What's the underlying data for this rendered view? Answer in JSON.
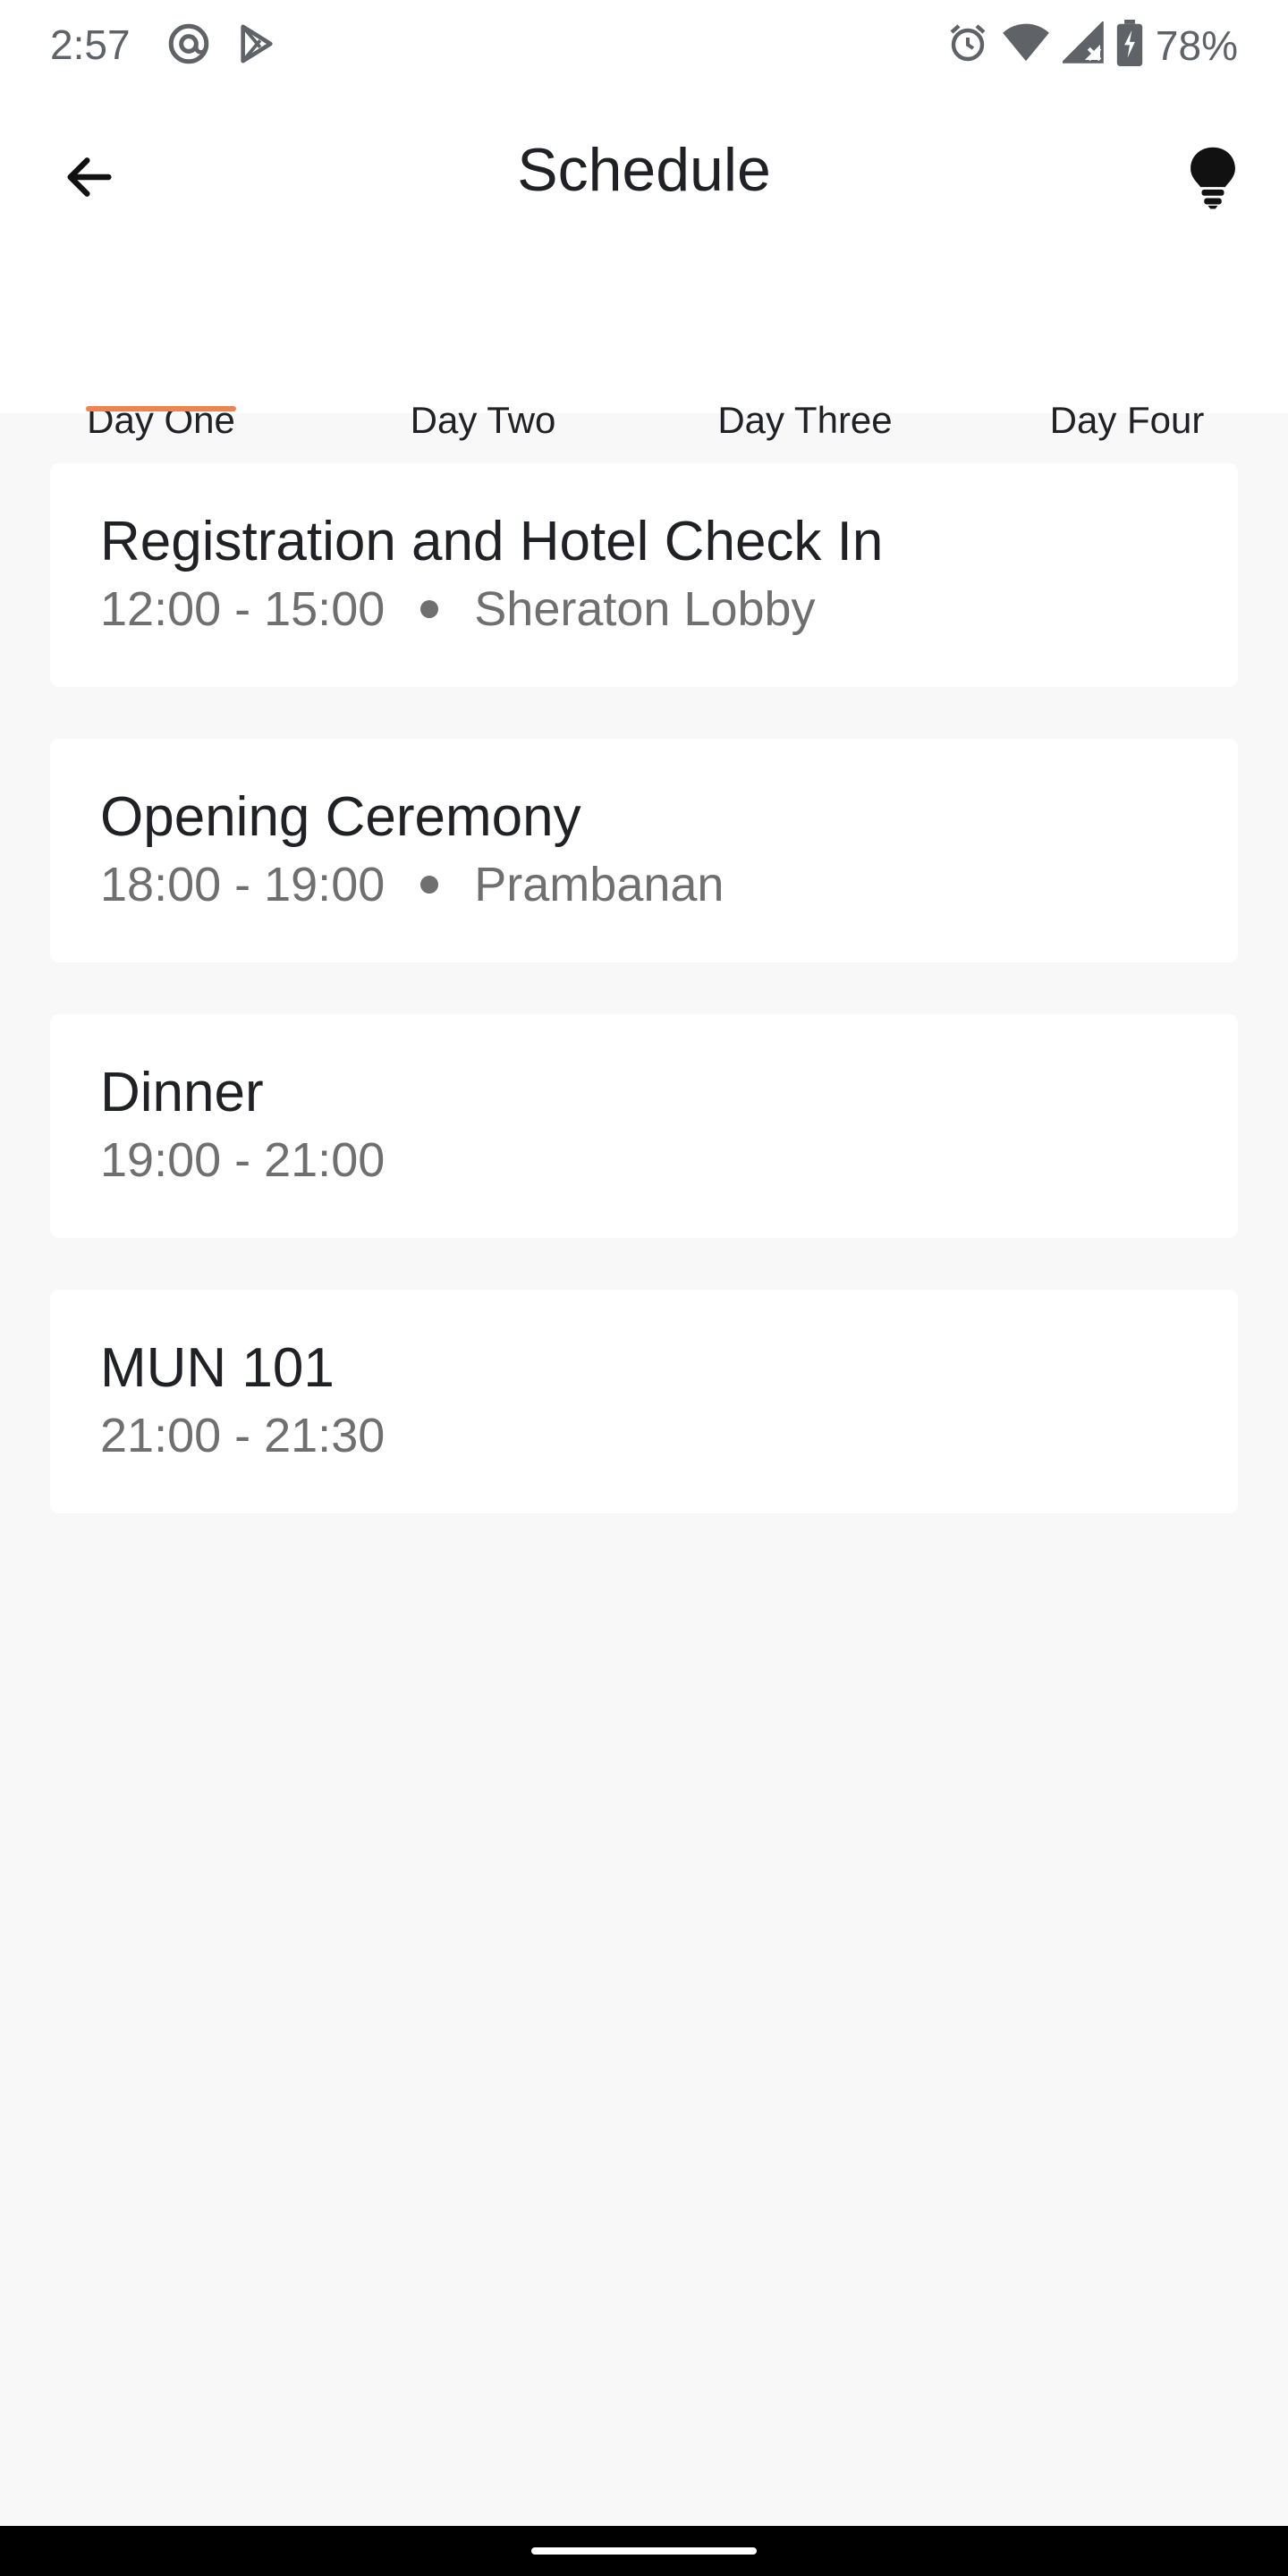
{
  "status_bar": {
    "time": "2:57",
    "battery_percent": "78%",
    "icons_left": [
      "at-sign-icon",
      "play-store-icon"
    ],
    "icons_right": [
      "alarm-icon",
      "wifi-icon",
      "cell-signal-icon",
      "battery-charging-icon"
    ]
  },
  "header": {
    "title": "Schedule",
    "back_icon": "arrow-left-icon",
    "action_icon": "lightbulb-icon"
  },
  "tabs": [
    {
      "label": "Day One",
      "selected": true
    },
    {
      "label": "Day Two",
      "selected": false
    },
    {
      "label": "Day Three",
      "selected": false
    },
    {
      "label": "Day Four",
      "selected": false
    }
  ],
  "events": [
    {
      "title": "Registration and Hotel Check In",
      "time": "12:00 - 15:00",
      "location": "Sheraton Lobby"
    },
    {
      "title": "Opening Ceremony",
      "time": "18:00 - 19:00",
      "location": "Prambanan"
    },
    {
      "title": "Dinner",
      "time": "19:00 - 21:00",
      "location": ""
    },
    {
      "title": "MUN 101",
      "time": "21:00 - 21:30",
      "location": ""
    }
  ],
  "colors": {
    "accent": "#ee8451",
    "background": "#f8f8f8",
    "card": "#ffffff",
    "text_primary": "#202124",
    "text_secondary": "#6f6f6f"
  }
}
